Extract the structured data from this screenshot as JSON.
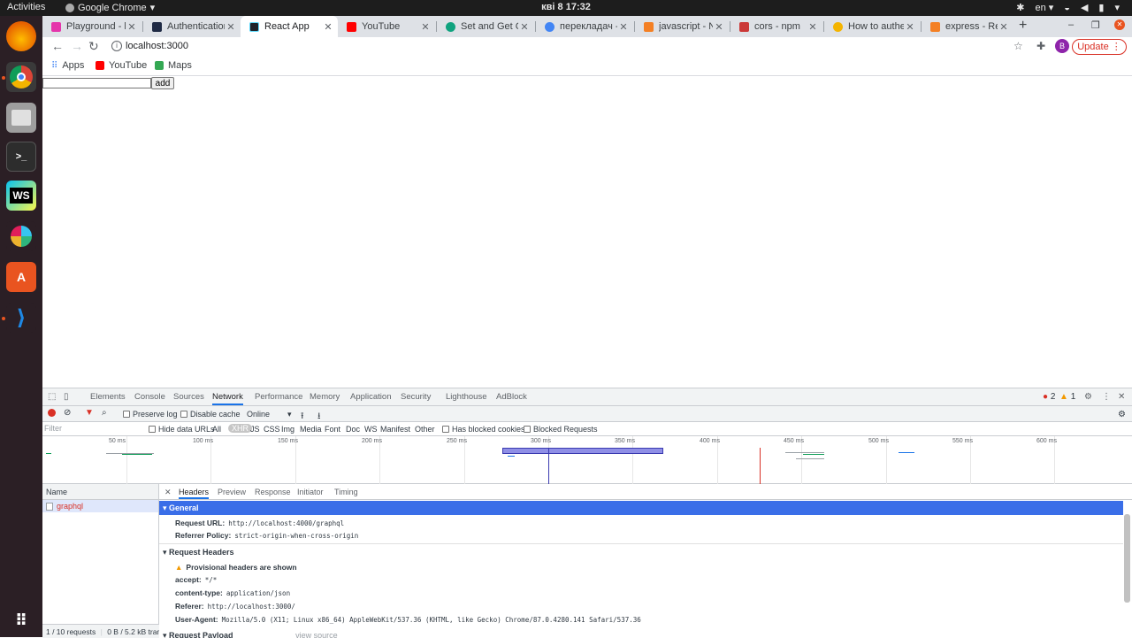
{
  "os": {
    "activities": "Activities",
    "app_name": "Google Chrome",
    "clock": "кві 8  17:32",
    "lang": "en"
  },
  "tabs": [
    {
      "title": "Playground - h",
      "color": "#e535ab"
    },
    {
      "title": "Authentication",
      "color": "#1f2a44"
    },
    {
      "title": "React App",
      "color": "#20232a",
      "active": true
    },
    {
      "title": "YouTube",
      "color": "#ff0000"
    },
    {
      "title": "Set and Get Co",
      "color": "#10a37f"
    },
    {
      "title": "перекладач - ",
      "color": "#4285f4"
    },
    {
      "title": "javascript - No",
      "color": "#f48024"
    },
    {
      "title": "cors - npm",
      "color": "#cb3837"
    },
    {
      "title": "How to auther",
      "color": "#f4b400"
    },
    {
      "title": "express - Reac",
      "color": "#f48024"
    }
  ],
  "toolbar": {
    "url": "localhost:3000",
    "avatar_letter": "B",
    "update_label": "Update"
  },
  "bookmarks": [
    {
      "label": "Apps",
      "color": "#4285f4"
    },
    {
      "label": "YouTube",
      "color": "#ff0000"
    },
    {
      "label": "Maps",
      "color": "#34a853"
    }
  ],
  "page": {
    "add_label": "add",
    "input_value": ""
  },
  "devtools": {
    "tabs": [
      "Elements",
      "Console",
      "Sources",
      "Network",
      "Performance",
      "Memory",
      "Application",
      "Security",
      "Lighthouse",
      "AdBlock"
    ],
    "active_tab": "Network",
    "error_count": "2",
    "warning_count": "1",
    "net_toolbar": {
      "preserve_log": "Preserve log",
      "disable_cache": "Disable cache",
      "throttle": "Online"
    },
    "filter": {
      "placeholder": "Filter",
      "hide_data_urls": "Hide data URLs",
      "types": [
        "All",
        "XHR",
        "JS",
        "CSS",
        "Img",
        "Media",
        "Font",
        "Doc",
        "WS",
        "Manifest",
        "Other"
      ],
      "has_blocked_cookies": "Has blocked cookies",
      "blocked_requests": "Blocked Requests"
    },
    "timeline_ticks": [
      "50 ms",
      "100 ms",
      "150 ms",
      "200 ms",
      "250 ms",
      "300 ms",
      "350 ms",
      "400 ms",
      "450 ms",
      "500 ms",
      "550 ms",
      "600 ms",
      "650 ms"
    ],
    "list": {
      "header": "Name",
      "rows": [
        "graphql"
      ],
      "status": "1 / 10 requests",
      "transfer": "0 B / 5.2 kB tran"
    },
    "detail_tabs": [
      "Headers",
      "Preview",
      "Response",
      "Initiator",
      "Timing"
    ],
    "general": {
      "title": "General",
      "request_url_k": "Request URL:",
      "request_url_v": "http://localhost:4000/graphql",
      "referrer_policy_k": "Referrer Policy:",
      "referrer_policy_v": "strict-origin-when-cross-origin"
    },
    "request_headers": {
      "title": "Request Headers",
      "provisional": "Provisional headers are shown",
      "accept_k": "accept:",
      "accept_v": "*/*",
      "content_type_k": "content-type:",
      "content_type_v": "application/json",
      "referer_k": "Referer:",
      "referer_v": "http://localhost:3000/",
      "user_agent_k": "User-Agent:",
      "user_agent_v": "Mozilla/5.0 (X11; Linux x86_64) AppleWebKit/537.36 (KHTML, like Gecko) Chrome/87.0.4280.141 Safari/537.36"
    },
    "request_payload": {
      "title": "Request Payload",
      "view_source": "view source"
    }
  }
}
